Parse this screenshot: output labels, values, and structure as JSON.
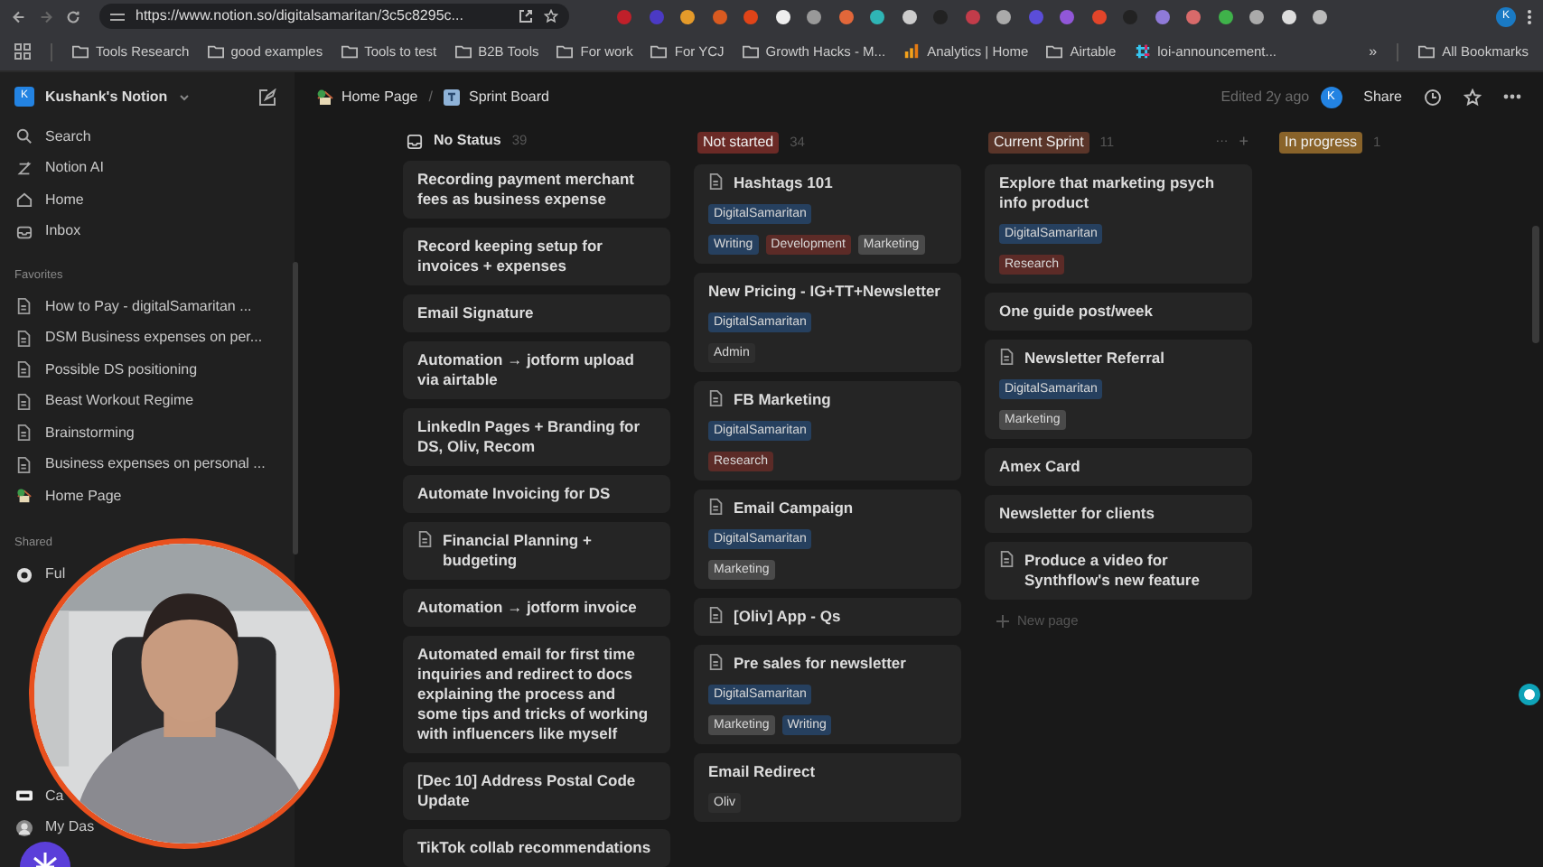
{
  "browser": {
    "url": "https://www.notion.so/digitalsamaritan/3c5c8295c...",
    "bookmarks": [
      {
        "label": "Tools Research",
        "kind": "folder"
      },
      {
        "label": "good examples",
        "kind": "folder"
      },
      {
        "label": "Tools to test",
        "kind": "folder"
      },
      {
        "label": "B2B Tools",
        "kind": "folder"
      },
      {
        "label": "For work",
        "kind": "folder"
      },
      {
        "label": "For YCJ",
        "kind": "folder"
      },
      {
        "label": "Growth Hacks - M...",
        "kind": "folder"
      },
      {
        "label": "Analytics | Home",
        "kind": "chart"
      },
      {
        "label": "Airtable",
        "kind": "folder"
      },
      {
        "label": "loi-announcement...",
        "kind": "slack"
      }
    ],
    "more": "»",
    "all_bookmarks": "All Bookmarks",
    "profile": "K"
  },
  "sidebar": {
    "workspace": "Kushank's Notion",
    "workspace_initial": "K",
    "nav": [
      {
        "label": "Search",
        "kind": "search"
      },
      {
        "label": "Notion AI",
        "kind": "ai"
      },
      {
        "label": "Home",
        "kind": "home"
      },
      {
        "label": "Inbox",
        "kind": "inbox"
      }
    ],
    "favorites_heading": "Favorites",
    "favorites": [
      {
        "label": "How to Pay - digitalSamaritan ...",
        "kind": "doc"
      },
      {
        "label": "DSM Business expenses on per...",
        "kind": "doc"
      },
      {
        "label": "Possible DS positioning",
        "kind": "doc"
      },
      {
        "label": "Beast Workout Regime",
        "kind": "doc"
      },
      {
        "label": "Brainstorming",
        "kind": "doc"
      },
      {
        "label": "Business expenses on personal ...",
        "kind": "doc"
      },
      {
        "label": "Home Page",
        "kind": "house"
      }
    ],
    "shared_heading": "Shared",
    "shared": [
      {
        "label": "Ful",
        "kind": "circle"
      },
      {
        "label": "Ca",
        "kind": "badge"
      },
      {
        "label": "My Das",
        "kind": "avatar"
      }
    ]
  },
  "topbar": {
    "breadcrumbs": [
      {
        "label": "Home Page",
        "kind": "house"
      },
      {
        "label": "Sprint Board",
        "kind": "board"
      }
    ],
    "separator": "/",
    "edited": "Edited 2y ago",
    "avatar": "K",
    "share": "Share"
  },
  "board": {
    "columns": [
      {
        "title": "No Status",
        "count": "39",
        "kind": "plain",
        "cards": [
          {
            "title": "Recording payment merchant fees as business expense"
          },
          {
            "title": "Record keeping setup for invoices + expenses"
          },
          {
            "title": "Email Signature"
          },
          {
            "title": "Automation → jotform upload via airtable"
          },
          {
            "title": "LinkedIn Pages + Branding for DS, Oliv, Recom"
          },
          {
            "title": "Automate Invoicing for DS"
          },
          {
            "title": "Financial Planning + budgeting",
            "doc": true
          },
          {
            "title": "Automation → jotform invoice"
          },
          {
            "title": "Automated email for first time inquiries and redirect to docs explaining the process and some tips and tricks of working with influencers like myself"
          },
          {
            "title": "[Dec 10] Address Postal Code Update"
          },
          {
            "title": "TikTok collab recommendations"
          }
        ]
      },
      {
        "title": "Not started",
        "count": "34",
        "kind": "tag",
        "color": "#6b2a26",
        "cards": [
          {
            "title": "Hashtags 101",
            "doc": true,
            "tag_rows": [
              [
                {
                  "label": "DigitalSamaritan",
                  "color": "#26405f"
                }
              ],
              [
                {
                  "label": "Writing",
                  "color": "#26405f"
                },
                {
                  "label": "Development",
                  "color": "#5c2b27"
                },
                {
                  "label": "Marketing",
                  "color": "#4a4a4a"
                }
              ]
            ]
          },
          {
            "title": "New Pricing - IG+TT+Newsletter",
            "tag_rows": [
              [
                {
                  "label": "DigitalSamaritan",
                  "color": "#26405f"
                }
              ],
              [
                {
                  "label": "Admin",
                  "color": "#2e2e2e"
                }
              ]
            ]
          },
          {
            "title": "FB Marketing",
            "doc": true,
            "tag_rows": [
              [
                {
                  "label": "DigitalSamaritan",
                  "color": "#26405f"
                }
              ],
              [
                {
                  "label": "Research",
                  "color": "#5c2b27"
                }
              ]
            ]
          },
          {
            "title": "Email Campaign",
            "doc": true,
            "tag_rows": [
              [
                {
                  "label": "DigitalSamaritan",
                  "color": "#26405f"
                }
              ],
              [
                {
                  "label": "Marketing",
                  "color": "#4a4a4a"
                }
              ]
            ]
          },
          {
            "title": "[Oliv] App - Qs",
            "doc": true
          },
          {
            "title": "Pre sales for newsletter",
            "doc": true,
            "tag_rows": [
              [
                {
                  "label": "DigitalSamaritan",
                  "color": "#26405f"
                }
              ],
              [
                {
                  "label": "Marketing",
                  "color": "#4a4a4a"
                },
                {
                  "label": "Writing",
                  "color": "#26405f"
                }
              ]
            ]
          },
          {
            "title": "Email Redirect",
            "tag_rows": [
              [
                {
                  "label": "Oliv",
                  "color": "#2e2e2e"
                }
              ]
            ]
          }
        ]
      },
      {
        "title": "Current Sprint",
        "count": "11",
        "kind": "tag",
        "color": "#5a3529",
        "menu": "···",
        "add": "+",
        "cards": [
          {
            "title": "Explore that marketing psych info product",
            "tag_rows": [
              [
                {
                  "label": "DigitalSamaritan",
                  "color": "#26405f"
                }
              ],
              [
                {
                  "label": "Research",
                  "color": "#5c2b27"
                }
              ]
            ]
          },
          {
            "title": "One guide post/week"
          },
          {
            "title": "Newsletter Referral",
            "doc": true,
            "tag_rows": [
              [
                {
                  "label": "DigitalSamaritan",
                  "color": "#26405f"
                }
              ],
              [
                {
                  "label": "Marketing",
                  "color": "#4a4a4a"
                }
              ]
            ]
          },
          {
            "title": "Amex Card"
          },
          {
            "title": "Newsletter for clients"
          },
          {
            "title": "Produce a video for Synthflow's new feature",
            "doc": true
          }
        ],
        "new_page": "New page"
      },
      {
        "title": "In progress",
        "count": "1",
        "kind": "tag",
        "color": "#89632a"
      }
    ]
  }
}
